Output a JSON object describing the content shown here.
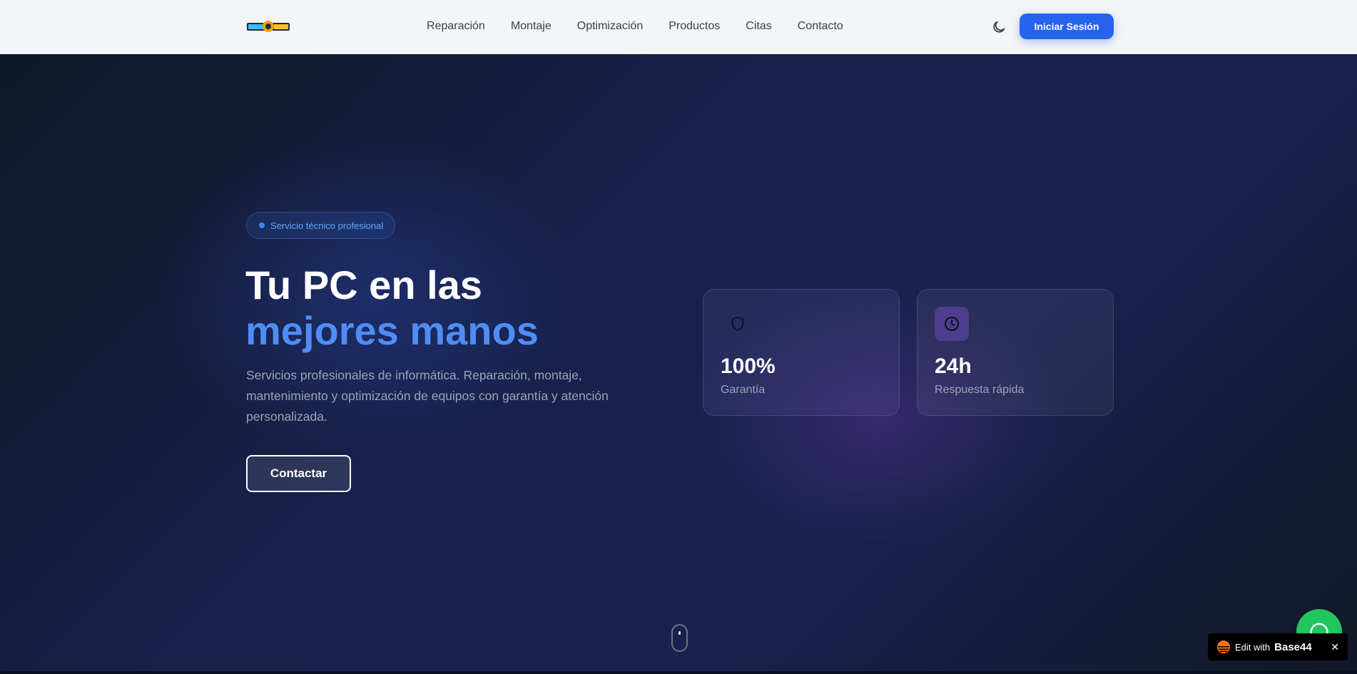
{
  "navbar": {
    "logo_name": "logo-icon",
    "links": [
      "Reparación",
      "Montaje",
      "Optimización",
      "Productos",
      "Citas",
      "Contacto"
    ],
    "theme_icon": "moon-icon",
    "login_label": "Iniciar Sesión"
  },
  "hero": {
    "badge_text": "Servicio técnico profesional",
    "headline_line1": "Tu PC en las",
    "headline_line2": "mejores manos",
    "description": "Servicios profesionales de informática. Reparación, montaje, mantenimiento y optimización de equipos con garantía y atención personalizada.",
    "cta_label": "Contactar",
    "stats": [
      {
        "icon": "shield-icon",
        "value": "100%",
        "label": "Garantía"
      },
      {
        "icon": "clock-icon",
        "value": "24h",
        "label": "Respuesta rápida"
      }
    ]
  },
  "floating": {
    "whatsapp_icon": "whatsapp-icon",
    "base44_prefix": "Edit with",
    "base44_brand": "Base44",
    "base44_close": "✕"
  },
  "colors": {
    "accent": "#2563eb",
    "headline_accent": "#4f8df5",
    "whatsapp": "#22c55e"
  }
}
